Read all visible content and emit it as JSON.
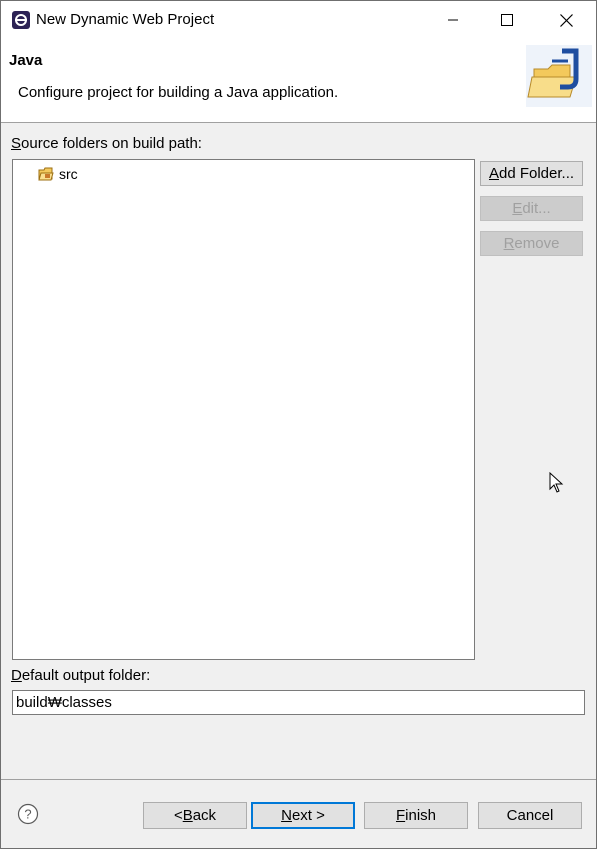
{
  "window": {
    "title": "New Dynamic Web Project"
  },
  "banner": {
    "title": "Java",
    "description": "Configure project for building a Java application."
  },
  "source": {
    "label_prefix": "",
    "label_accel": "S",
    "label_rest": "ource folders on build path:",
    "items": [
      {
        "label": "src",
        "icon": "source-folder-icon"
      }
    ]
  },
  "side_buttons": {
    "add": {
      "accel": "A",
      "rest": "dd Folder..."
    },
    "edit": {
      "accel": "E",
      "rest": "dit..."
    },
    "remove": {
      "accel": "R",
      "rest": "emove"
    }
  },
  "output": {
    "label_accel": "D",
    "label_rest": "efault output folder:",
    "value": "build₩classes"
  },
  "footer": {
    "back": {
      "pre": "< ",
      "accel": "B",
      "rest": "ack"
    },
    "next": {
      "accel": "N",
      "rest": "ext >"
    },
    "finish": {
      "accel": "F",
      "rest": "inish"
    },
    "cancel": {
      "label": "Cancel"
    }
  },
  "colors": {
    "accent": "#0078d7",
    "disabled_text": "#a0a0a0"
  },
  "icons": [
    "eclipse-app-icon",
    "minimize-icon",
    "maximize-icon",
    "close-icon",
    "java-folder-banner-icon",
    "source-folder-icon",
    "help-icon",
    "mouse-cursor-icon"
  ]
}
